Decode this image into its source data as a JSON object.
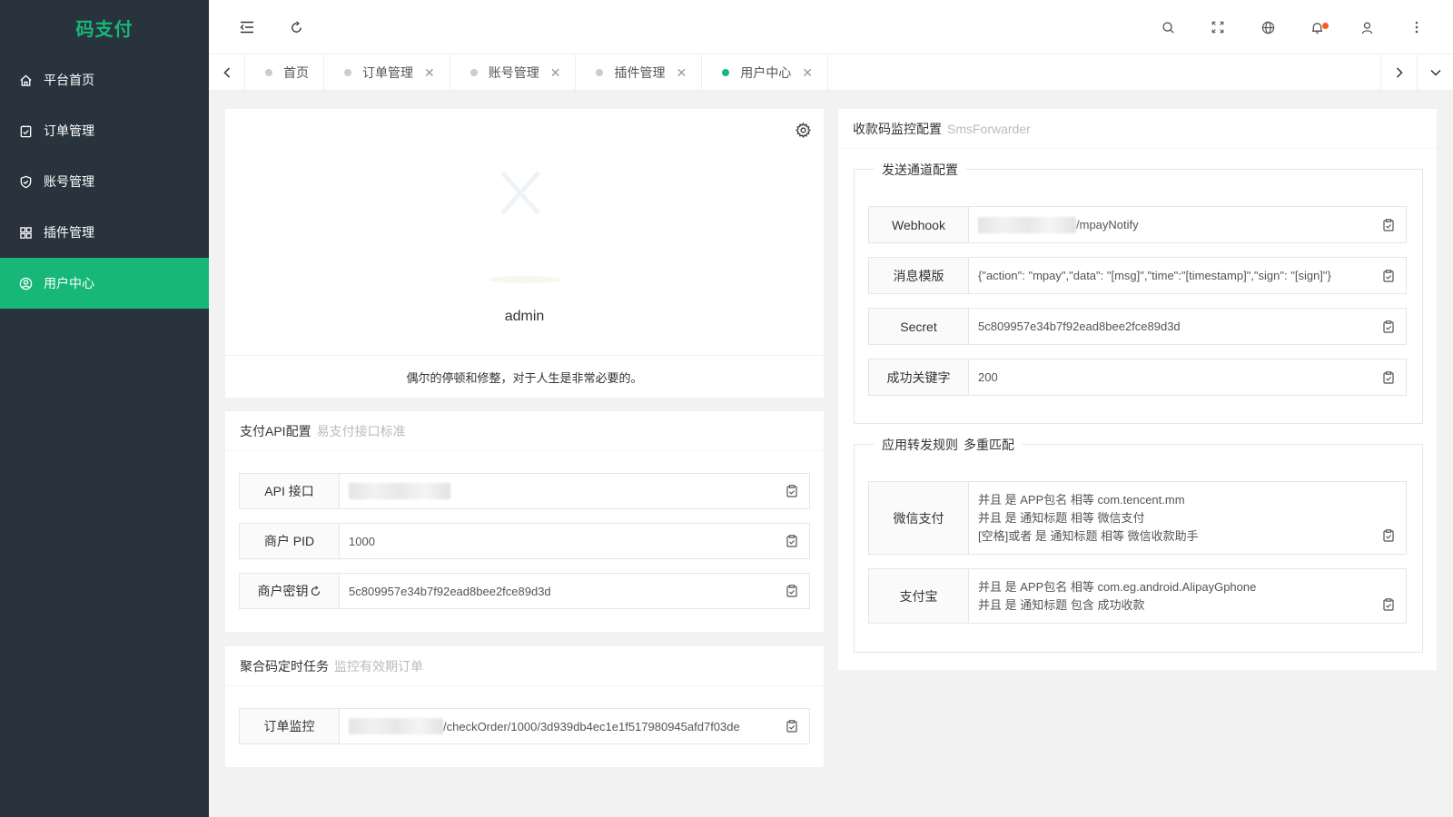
{
  "app": {
    "logo": "码支付"
  },
  "sidebar": {
    "items": [
      {
        "label": "平台首页",
        "icon": "home-icon"
      },
      {
        "label": "订单管理",
        "icon": "order-icon"
      },
      {
        "label": "账号管理",
        "icon": "shield-icon"
      },
      {
        "label": "插件管理",
        "icon": "grid-icon"
      },
      {
        "label": "用户中心",
        "icon": "user-circle-icon",
        "active": true
      }
    ]
  },
  "tabs": [
    {
      "label": "首页",
      "closable": false
    },
    {
      "label": "订单管理",
      "closable": true,
      "close": "✕"
    },
    {
      "label": "账号管理",
      "closable": true,
      "close": "✕"
    },
    {
      "label": "插件管理",
      "closable": true,
      "close": "✕"
    },
    {
      "label": "用户中心",
      "closable": true,
      "close": "✕",
      "active": true
    }
  ],
  "profile": {
    "username": "admin",
    "motto": "偶尔的停顿和修整，对于人生是非常必要的。"
  },
  "pay_api": {
    "title": "支付API配置",
    "subtitle": "易支付接口标准",
    "fields": [
      {
        "label": "API 接口",
        "value": ""
      },
      {
        "label": "商户 PID",
        "value": "1000"
      },
      {
        "label": "商户密钥",
        "value": "5c809957e34b7f92ead8bee2fce89d3d"
      }
    ]
  },
  "cron": {
    "title": "聚合码定时任务",
    "subtitle": "监控有效期订单",
    "fields": [
      {
        "label": "订单监控",
        "value": "/checkOrder/1000/3d939db4ec1e1f517980945afd7f03de"
      }
    ]
  },
  "monitor": {
    "title": "收款码监控配置",
    "subtitle": "SmsForwarder",
    "channel": {
      "legend": "发送通道配置",
      "fields": [
        {
          "label": "Webhook",
          "value": "/mpayNotify"
        },
        {
          "label": "消息模版",
          "value": "{\"action\": \"mpay\",\"data\": \"[msg]\",\"time\":\"[timestamp]\",\"sign\": \"[sign]\"}"
        },
        {
          "label": "Secret",
          "value": "5c809957e34b7f92ead8bee2fce89d3d"
        },
        {
          "label": "成功关键字",
          "value": "200"
        }
      ]
    },
    "rules": {
      "legend": "应用转发规则",
      "legend_sub": "多重匹配",
      "items": [
        {
          "label": "微信支付",
          "lines": [
            "并且 是 APP包名 相等 com.tencent.mm",
            "并且 是 通知标题 相等 微信支付",
            "[空格]或者 是 通知标题 相等 微信收款助手"
          ]
        },
        {
          "label": "支付宝",
          "lines": [
            "并且 是 APP包名 相等 com.eg.android.AlipayGphone",
            "并且 是 通知标题 包含 成功收款"
          ]
        }
      ]
    }
  },
  "colors": {
    "brand": "#16b777",
    "sidebar": "#28333e",
    "notify": "#ff5722"
  }
}
